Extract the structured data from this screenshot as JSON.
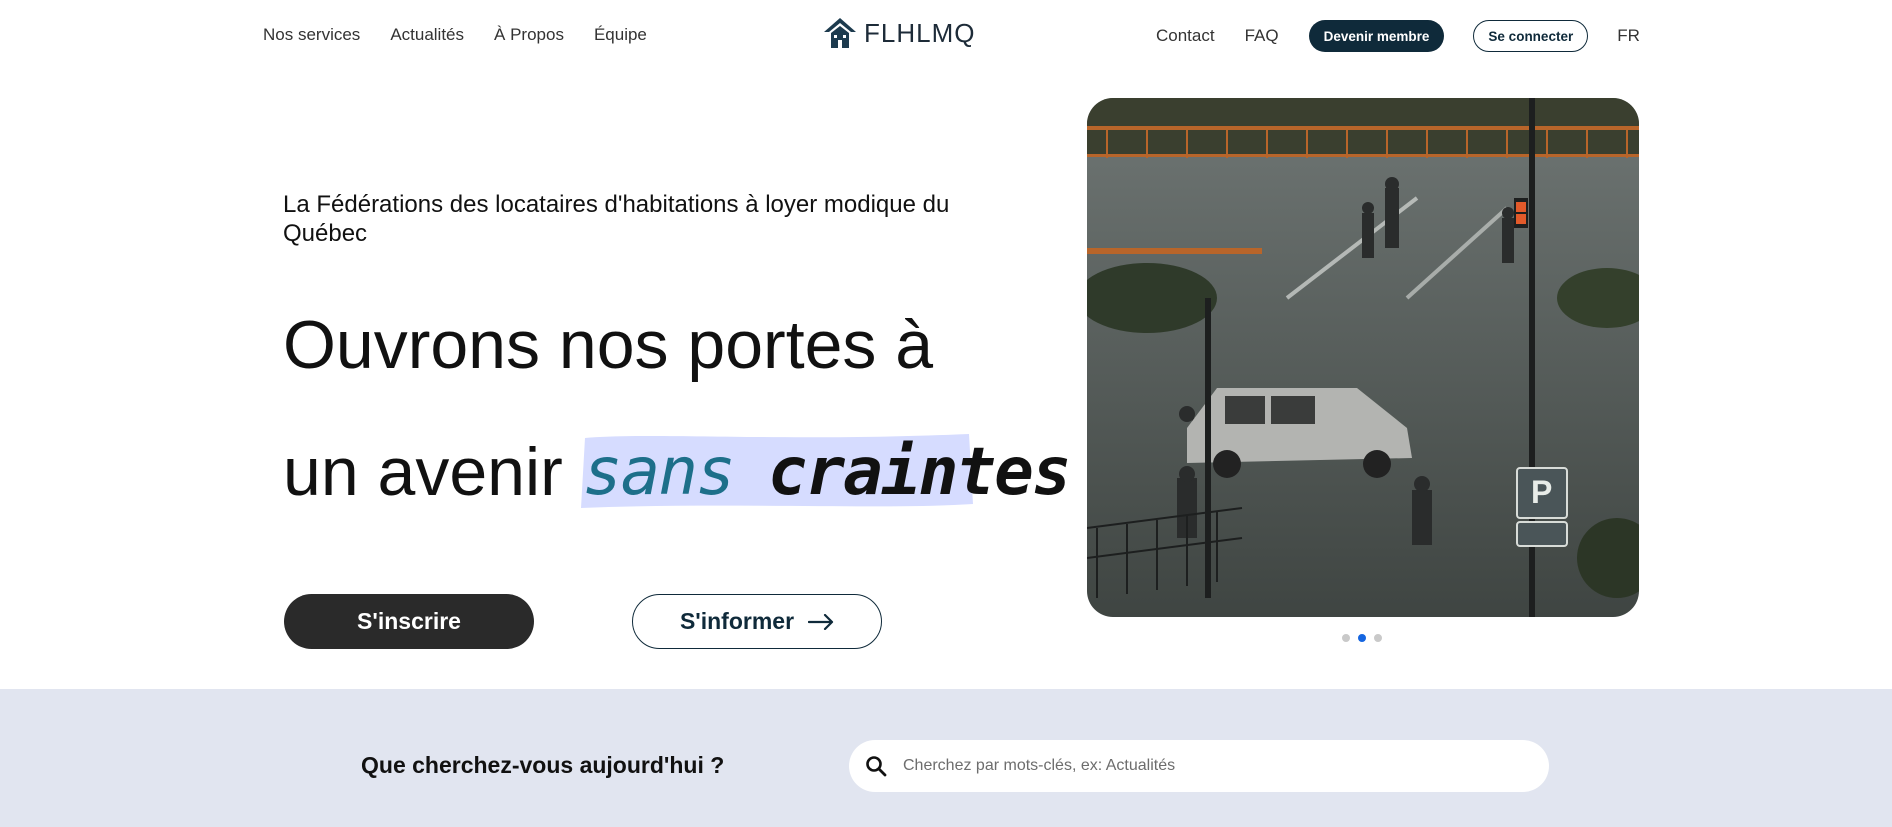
{
  "header": {
    "nav_left": [
      "Nos services",
      "Actualités",
      "À Propos",
      "Équipe"
    ],
    "logo_text": "FLHLMQ",
    "nav_right": [
      "Contact",
      "FAQ"
    ],
    "member_button": "Devenir membre",
    "login_button": "Se connecter",
    "language": "FR"
  },
  "hero": {
    "subtitle": "La Fédérations des locataires d'habitations à loyer modique du Québec",
    "headline_line1": "Ouvrons nos portes à",
    "headline_line2_prefix": "un avenir",
    "highlight_word1": "sans",
    "highlight_word2": "craintes",
    "signup_button": "S'inscrire",
    "inform_button": "S'informer",
    "colors": {
      "highlight_bg": "#d6dcff",
      "highlight_word1": "#1d6f8a",
      "dark": "#0f2a3a"
    }
  },
  "carousel": {
    "slide_count": 3,
    "active_index": 1,
    "image_subject": "flooded street with people and a car in water",
    "colors": {
      "active_dot": "#1565e0",
      "inactive_dot": "#c9c9c9"
    }
  },
  "search": {
    "question": "Que cherchez-vous aujourd'hui ?",
    "placeholder": "Cherchez par mots-clés, ex: Actualités",
    "value": "",
    "icon": "search-icon",
    "background": "#e1e5f0"
  }
}
